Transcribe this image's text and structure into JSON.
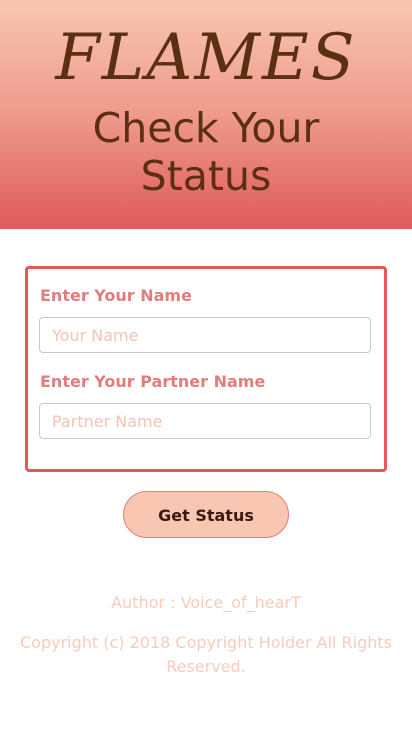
{
  "header": {
    "logo": "FLAMES",
    "subtitle_line1": "Check Your",
    "subtitle_line2": "Status"
  },
  "form": {
    "name_label": "Enter Your Name",
    "name_placeholder": "Your Name",
    "partner_label": "Enter Your Partner Name",
    "partner_placeholder": "Partner Name"
  },
  "actions": {
    "submit_label": "Get Status"
  },
  "footer": {
    "author": "Author : Voice_of_hearT",
    "copyright_line1": "Copyright (c) 2018 Copyright Holder All Rights",
    "copyright_line2": "Reserved."
  }
}
